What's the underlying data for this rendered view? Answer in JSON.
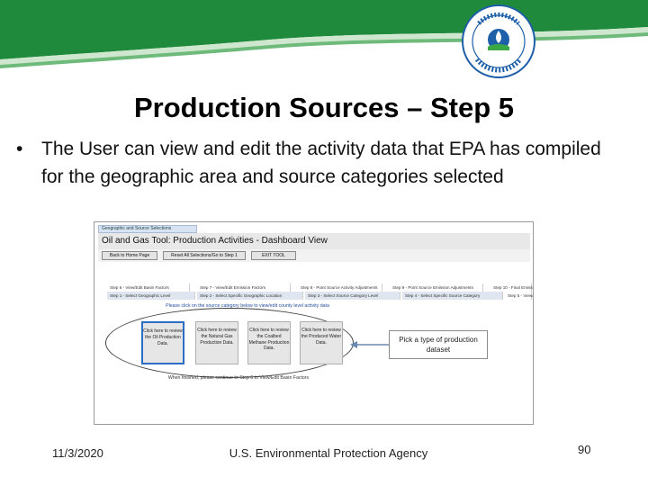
{
  "slide": {
    "title": "Production Sources – Step 5",
    "bullet": "The User can view and edit the activity data that EPA has compiled for the geographic area and source categories selected"
  },
  "footer": {
    "date": "11/3/2020",
    "agency": "U.S. Environmental Protection Agency",
    "page_number": "90"
  },
  "screenshot": {
    "tab_label": "Geographic and Source Selections",
    "window_title": "Oil and Gas Tool: Production Activities - Dashboard View",
    "buttons": [
      "Back to Home Page",
      "Reset All Selections/Go to Step 1",
      "EXIT TOOL"
    ],
    "steps_top": [
      "Step 6 - View/Edit Basin Factors",
      "Step 7 - View/Edit Emission Factors",
      "Step 8 - Point Source Activity Adjustments",
      "Step 9 - Point Source Emission Adjustments",
      "Step 10 - Final Emissions"
    ],
    "steps_bottom": [
      "Step 1 - Select Geographic Level",
      "Step 2 - Select Specific Geographic Location",
      "Step 3 - Select Source Category Level",
      "Step 4 - Select Specific Source Category",
      "Step 5 - View/E"
    ],
    "instruction": "Please click on the source category below to view/edit county level activity data",
    "finish_note": "When finished, please continue to Step 6 to View/Edit Basin Factors",
    "categories": [
      "Click here to review the Oil Production Data.",
      "Click here to review the Natural Gas Production Data.",
      "Click here to review the Coalbed Methane Production Data.",
      "Click here to review the Produced Water Data."
    ],
    "callout": "Pick a type of production dataset"
  },
  "colors": {
    "banner_green": "#1f8a3b",
    "banner_blue": "#1d5fa8",
    "selection_blue": "#2a6fc4"
  }
}
